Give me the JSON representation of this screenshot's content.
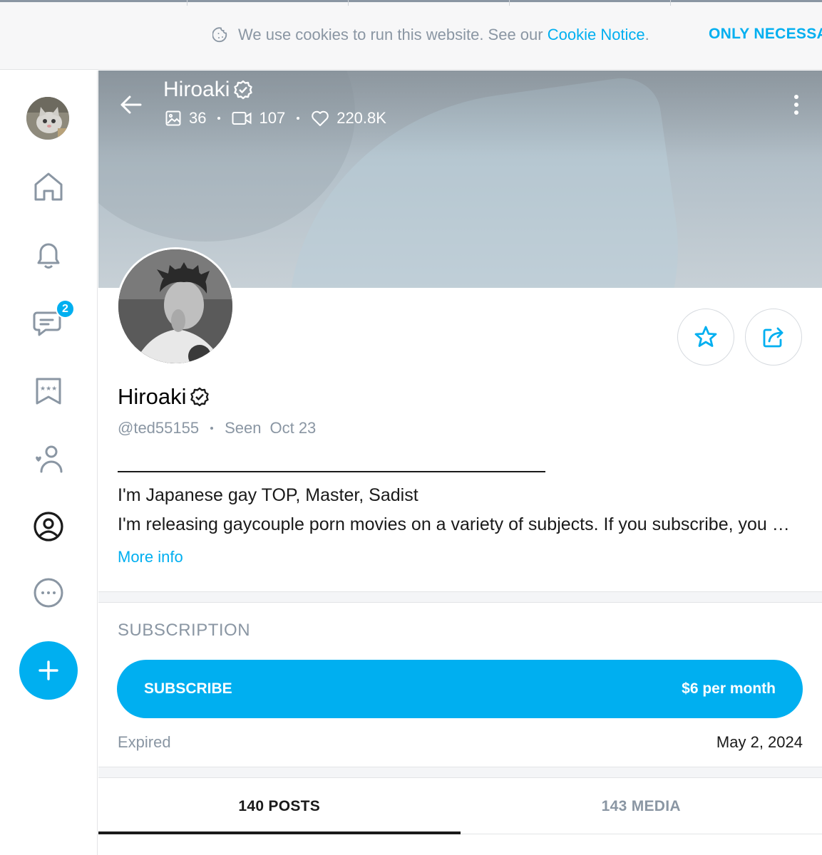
{
  "cookie_bar": {
    "message": "We use cookies to run this website. See our",
    "link_text": "Cookie Notice",
    "period": ".",
    "button_label": "ONLY NECESSA"
  },
  "sidebar": {
    "messages_badge": "2",
    "items": [
      {
        "name": "home-icon"
      },
      {
        "name": "bell-icon"
      },
      {
        "name": "messages-icon"
      },
      {
        "name": "bookmarks-icon"
      },
      {
        "name": "subscriptions-icon"
      },
      {
        "name": "profile-icon"
      },
      {
        "name": "more-icon"
      }
    ]
  },
  "header": {
    "name": "Hiroaki",
    "photos_count": "36",
    "videos_count": "107",
    "likes_count": "220.8K"
  },
  "profile": {
    "name": "Hiroaki",
    "handle": "@ted55155",
    "seen_label": "Seen",
    "seen_date": "Oct 23",
    "bio_line1": "I'm Japanese gay TOP, Master, Sadist",
    "bio_line2": "I'm releasing gaycouple porn movies on a variety of subjects. If you subscribe, you can watch all of the videos",
    "more_info": "More info"
  },
  "subscription": {
    "title": "SUBSCRIPTION",
    "button_label": "SUBSCRIBE",
    "price": "$6 per month",
    "status_label": "Expired",
    "status_date": "May 2, 2024"
  },
  "tabs": [
    {
      "label": "140 POSTS",
      "active": true
    },
    {
      "label": "143 MEDIA",
      "active": false
    }
  ],
  "colors": {
    "accent": "#00aff0",
    "muted": "#8a96a3",
    "text": "#1a1a1a"
  }
}
